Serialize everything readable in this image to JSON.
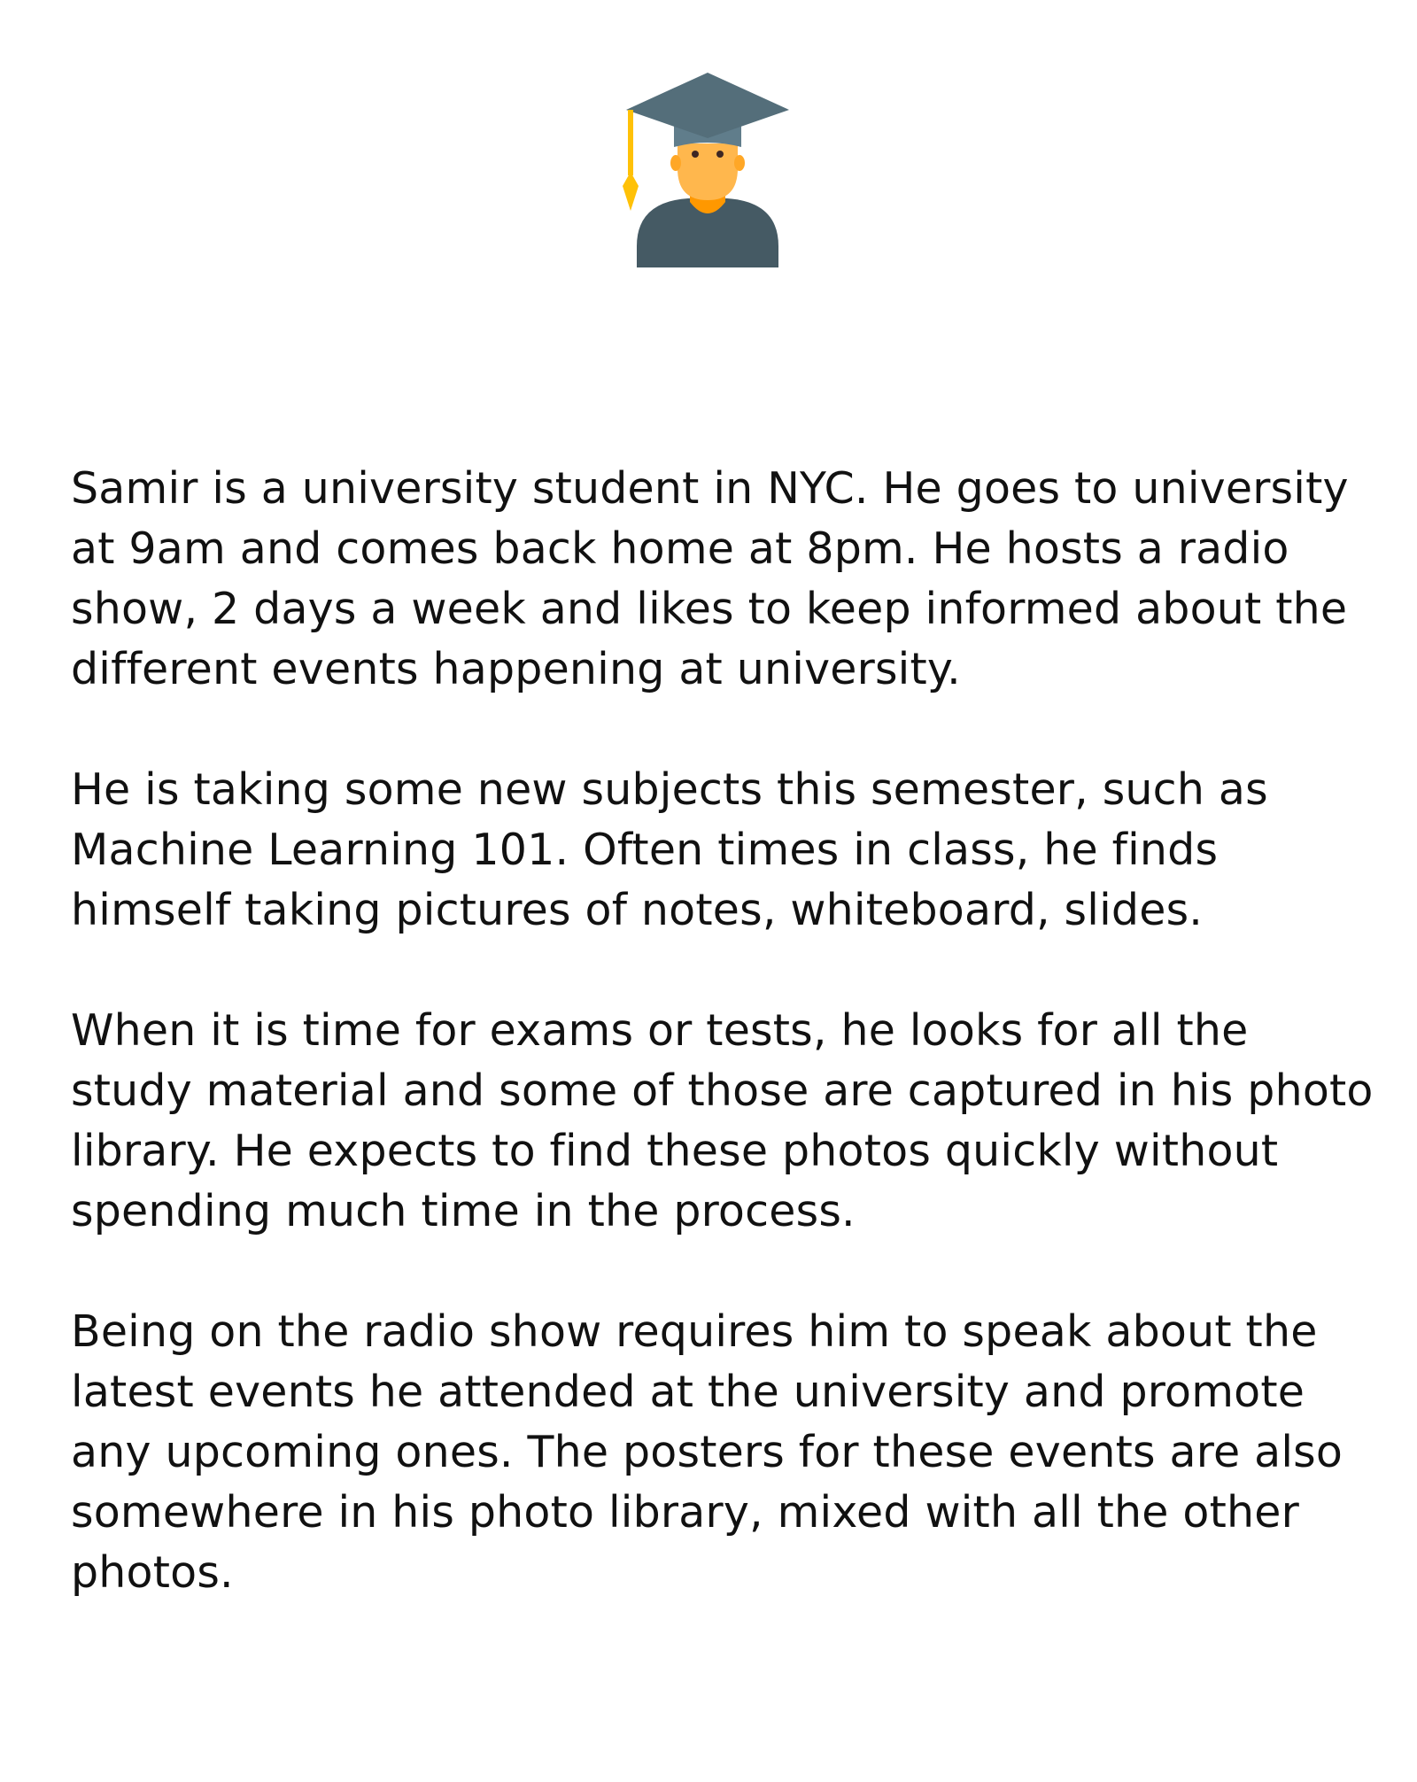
{
  "header": {
    "icon": "graduate-student-icon",
    "colors": {
      "cap": "#546e7a",
      "cap_band": "#607d8b",
      "tassel": "#ffc107",
      "face": "#ffb74d",
      "neck": "#ff9800",
      "body": "#455a64"
    }
  },
  "story": {
    "paragraphs": [
      "Samir is a university student in NYC. He goes to university at 9am and comes back home at 8pm. He hosts a radio show, 2 days a week and likes to keep informed about the different events happening at university.",
      "He is taking some new subjects this semester, such as Machine Learning 101. Often times in class, he finds himself taking pictures of notes, whiteboard, slides.",
      "When it is time for exams or tests, he looks for all the study material and some of those are captured in his photo library. He expects to find these photos quickly without spending much time in the process.",
      "Being on the radio show requires him to speak about the latest events he attended at the university and promote any upcoming ones. The posters for these events are also somewhere in his photo library, mixed with all the other photos."
    ]
  }
}
